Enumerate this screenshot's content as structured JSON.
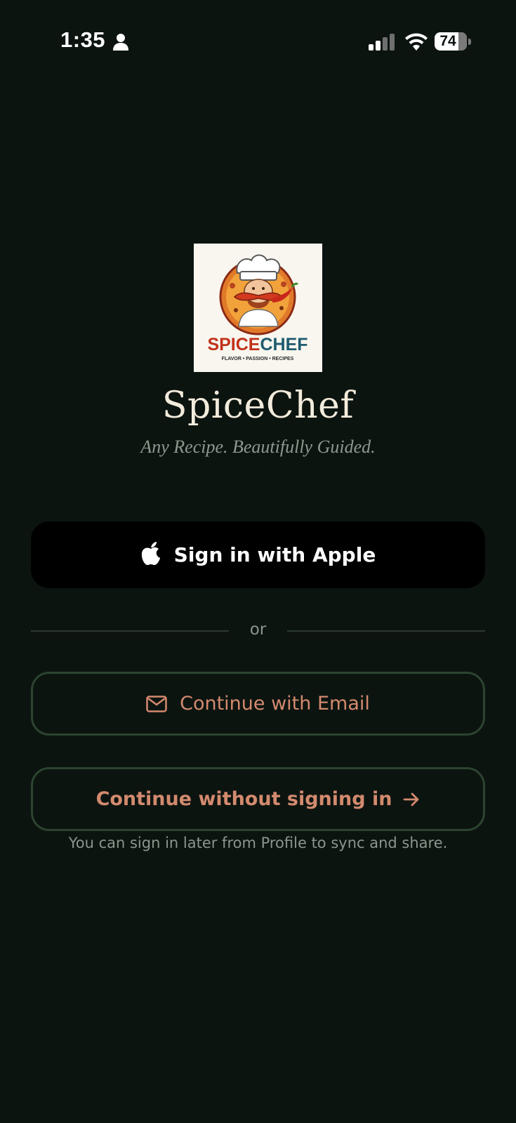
{
  "status_bar": {
    "time": "1:35",
    "battery_level": "74",
    "battery_fraction": 0.74,
    "icons": [
      "person-icon",
      "cellular-signal-icon",
      "wifi-icon",
      "battery-icon"
    ]
  },
  "brand": {
    "app_name": "SpiceChef",
    "tagline": "Any Recipe. Beautifully Guided.",
    "logo_text": "SPICECHEF",
    "logo_subtext": "FLAVOR • PASSION • RECIPES"
  },
  "auth": {
    "apple_label": "Sign in with Apple",
    "divider_label": "or",
    "email_label": "Continue with Email",
    "guest_label": "Continue without signing in",
    "helper_text": "You can sign in later from Profile to sync and share."
  },
  "colors": {
    "background": "#0c1410",
    "accent": "#d38a6e",
    "outline": "#2c4430",
    "title": "#f3ecdc",
    "muted": "#8a968c"
  }
}
